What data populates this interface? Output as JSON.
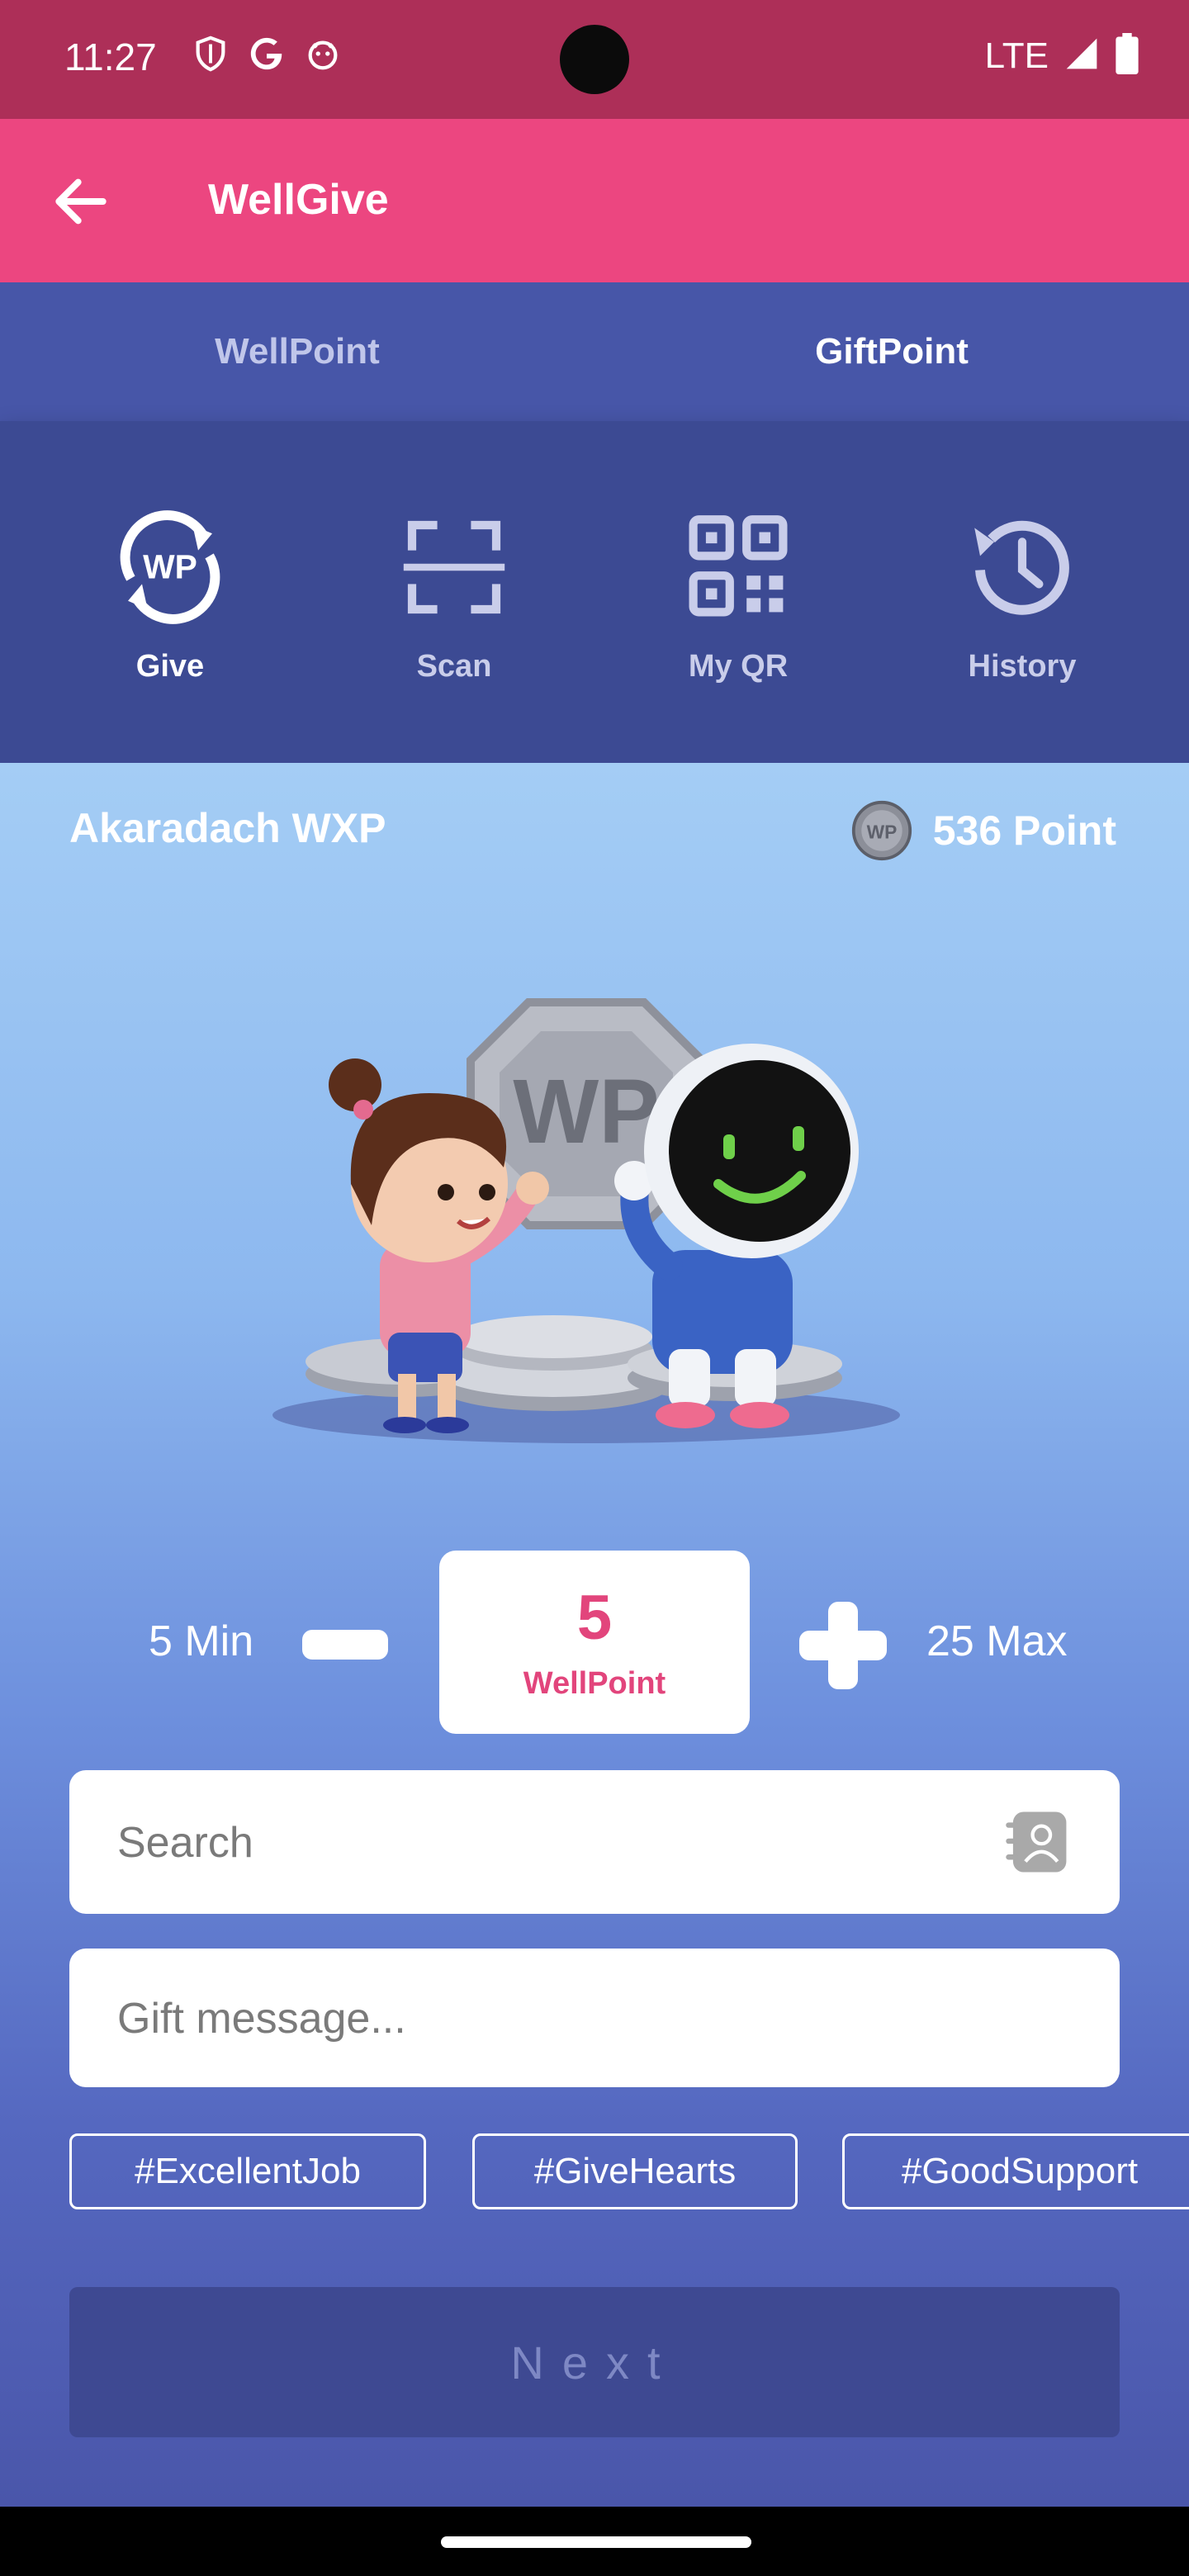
{
  "status_bar": {
    "time": "11:27",
    "network": "LTE",
    "icons": [
      "shield-icon",
      "google-icon",
      "notification-face-icon",
      "signal-icon",
      "battery-icon"
    ]
  },
  "app_bar": {
    "title": "WellGive",
    "back_icon": "arrow-left-icon"
  },
  "tabs": [
    {
      "label": "WellPoint",
      "active": false
    },
    {
      "label": "GiftPoint",
      "active": true
    }
  ],
  "actions": [
    {
      "label": "Give",
      "icon": "wp-give-icon",
      "active": true
    },
    {
      "label": "Scan",
      "icon": "scan-icon",
      "active": false
    },
    {
      "label": "My QR",
      "icon": "qr-code-icon",
      "active": false
    },
    {
      "label": "History",
      "icon": "history-icon",
      "active": false
    }
  ],
  "user": {
    "name": "Akaradach WXP",
    "coin_text": "WP",
    "points": "536 Point"
  },
  "illustration": {
    "icon": "wp-coins-characters-illustration",
    "coin_text": "WP"
  },
  "stepper": {
    "min_label": "5 Min",
    "max_label": "25 Max",
    "value": "5",
    "unit": "WellPoint"
  },
  "search": {
    "placeholder": "Search",
    "icon": "contacts-icon"
  },
  "gift_message": {
    "placeholder": "Gift message..."
  },
  "tags": [
    "#ExcellentJob",
    "#GiveHearts",
    "#GoodSupport"
  ],
  "next_button": {
    "label": "Next",
    "enabled": false
  },
  "colors": {
    "status_bar": "#ad2f58",
    "app_bar": "#ec4680",
    "tabs": "#4756a8",
    "actions": "#3c4a93",
    "accent": "#e2457c",
    "next_button": "#3e4992"
  }
}
